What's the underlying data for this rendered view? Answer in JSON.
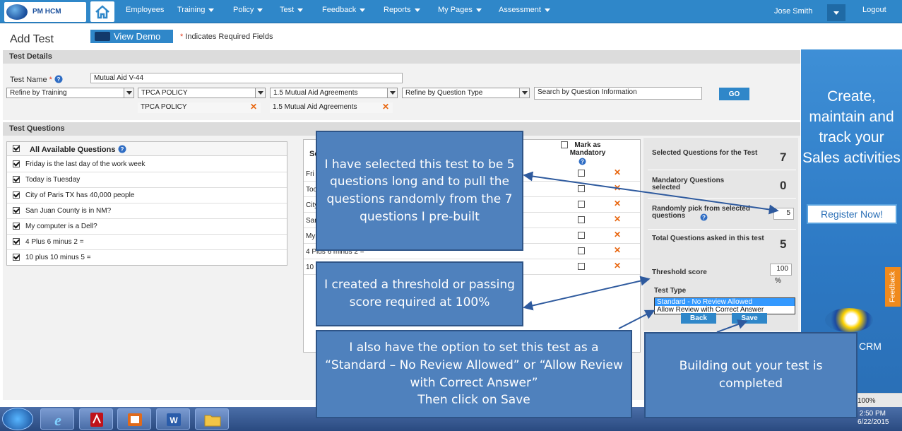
{
  "brand": {
    "logo_text": "PM HCM"
  },
  "nav": {
    "items": [
      {
        "label": "Employees",
        "dropdown": false
      },
      {
        "label": "Training",
        "dropdown": true
      },
      {
        "label": "Policy",
        "dropdown": true
      },
      {
        "label": "Test",
        "dropdown": true
      },
      {
        "label": "Feedback",
        "dropdown": true
      },
      {
        "label": "Reports",
        "dropdown": true
      },
      {
        "label": "My Pages",
        "dropdown": true
      },
      {
        "label": "Assessment",
        "dropdown": true
      }
    ],
    "user": "Jose Smith",
    "logout": "Logout"
  },
  "page": {
    "title": "Add Test",
    "view_demo": "View Demo",
    "required_note": "Indicates Required Fields"
  },
  "test_details": {
    "header": "Test Details",
    "name_label": "Test Name",
    "name_value": "Mutual Aid V-44",
    "filters": {
      "training": "Refine by Training",
      "policy": "TPCA POLICY",
      "agreement": "1.5 Mutual Aid Agreements",
      "question_type": "Refine by Question Type",
      "search_placeholder": "Search by Question Information",
      "go": "GO"
    },
    "chips": [
      "TPCA POLICY",
      "1.5 Mutual Aid Agreements"
    ]
  },
  "questions": {
    "header": "Test Questions",
    "all_available": "All Available Questions",
    "available": [
      "Friday is the last day of the work week",
      "Today is Tuesday",
      "City of Paris TX has 40,000 people",
      "San Juan County is in NM?",
      "My computer is a Dell?",
      "4 Plus 6 minus 2 =",
      "10 plus 10 minus 5 ="
    ],
    "selected_header": "Se",
    "mark_mandatory": "Mark as Mandatory",
    "selected_visible": [
      "Fri",
      "Too",
      "City",
      "San",
      "My",
      "4 Plus 6 minus 2 =",
      "10"
    ]
  },
  "summary": {
    "selected_label": "Selected Questions for the Test",
    "selected_value": "7",
    "mandatory_label": "Mandatory Questions selected",
    "mandatory_value": "0",
    "random_label": "Randomly pick from selected questions",
    "random_value": "5",
    "total_label": "Total Questions asked in this test",
    "total_value": "5",
    "threshold_label": "Threshold score",
    "threshold_value": "100",
    "threshold_unit": "%",
    "test_type_label": "Test Type",
    "test_type_options": [
      "Standard - No Review Allowed",
      "Allow Review with Correct Answer"
    ],
    "back": "Back",
    "save": "Save"
  },
  "ad": {
    "text": "Create, maintain and track your Sales activities",
    "button": "Register Now!",
    "crm": "CRM",
    "feedback_tab": "Feedback",
    "zoom": "100%"
  },
  "taskbar": {
    "time": "2:50 PM",
    "date": "6/22/2015"
  },
  "callouts": {
    "questions": "I have selected this test to be 5 questions long and to pull the questions randomly from the 7 questions I pre-built",
    "threshold": "I created a threshold or passing score required at 100%",
    "review": "I also have the option to set this test as a “Standard – No Review Allowed” or “Allow Review with Correct Answer”\nThen click on Save",
    "completed": "Building out your test is completed"
  },
  "colors": {
    "nav_blue": "#2f87c9",
    "callout_blue": "#4f81bd",
    "accent_orange": "#e8660f"
  }
}
